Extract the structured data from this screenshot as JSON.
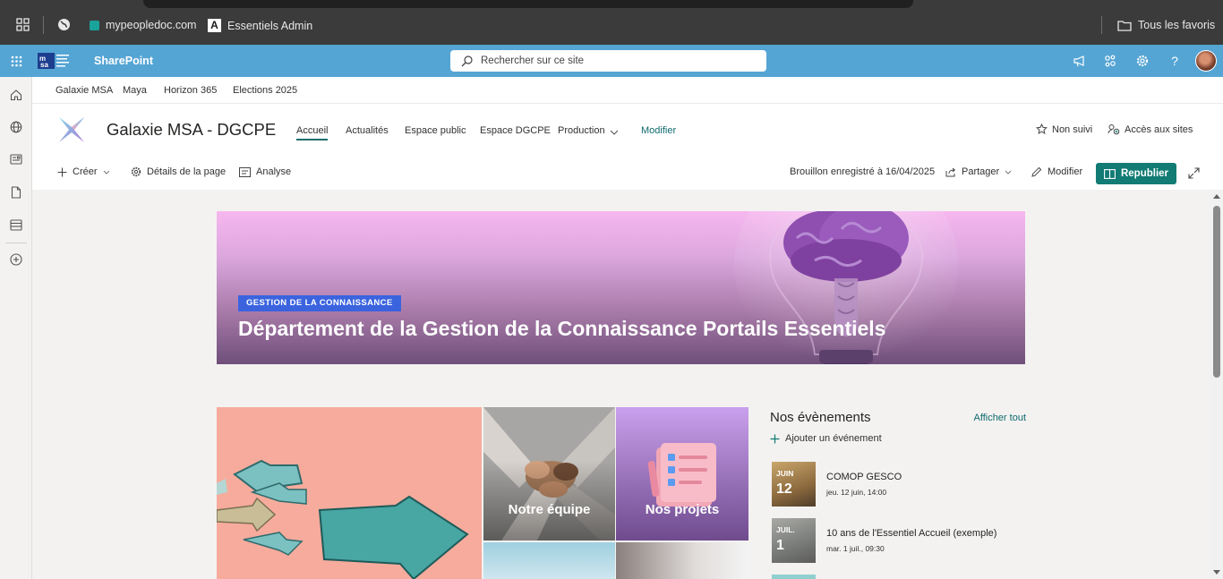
{
  "browser": {
    "bookmarks": [
      {
        "label": "mypeopledoc.com",
        "icon": "peopledoc-icon"
      },
      {
        "label": "Essentiels Admin",
        "icon": "admin-icon"
      }
    ],
    "favorites_label": "Tous les favoris"
  },
  "suite": {
    "brand": "SharePoint",
    "search_placeholder": "Rechercher sur ce site",
    "accent": "#55a5d4"
  },
  "hub_nav": [
    "Galaxie MSA",
    "Maya",
    "Horizon 365",
    "Elections 2025"
  ],
  "site": {
    "title": "Galaxie MSA - DGCPE",
    "nav": [
      "Accueil",
      "Actualités",
      "Espace public",
      "Espace DGCPE",
      "Production"
    ],
    "nav_edit": "Modifier",
    "follow": "Non suivi",
    "sites_access": "Accès aux sites"
  },
  "commands": {
    "create": "Créer",
    "page_details": "Détails de la page",
    "analytics": "Analyse",
    "draft_status": "Brouillon enregistré à 16/04/2025",
    "share": "Partager",
    "edit": "Modifier",
    "republish": "Republier",
    "primary_color": "#117b74"
  },
  "hero": {
    "tag": "GESTION DE LA CONNAISSANCE",
    "title": "Département de la Gestion de la Connaissance Portails Essentiels"
  },
  "tiles": [
    {
      "label": "Notre équipe"
    },
    {
      "label": "Nos projets"
    }
  ],
  "events": {
    "title": "Nos évènements",
    "show_all": "Afficher tout",
    "add": "Ajouter un événement",
    "items": [
      {
        "month": "JUIN",
        "day": "12",
        "title": "COMOP GESCO",
        "when": "jeu. 12 juin, 14:00"
      },
      {
        "month": "JUIL.",
        "day": "1",
        "title": "10 ans de l'Essentiel Accueil (exemple)",
        "when": "mar. 1 juil., 09:30"
      }
    ]
  }
}
